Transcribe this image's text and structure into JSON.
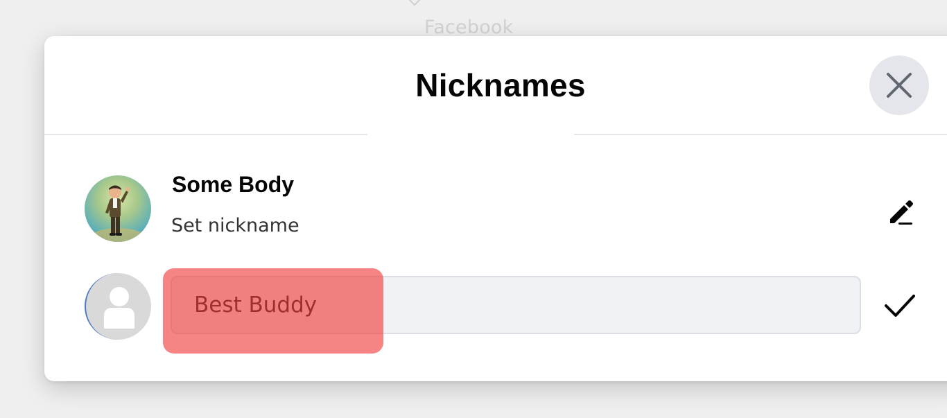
{
  "background": {
    "caption": "Facebook"
  },
  "dialog": {
    "title": "Nicknames",
    "close_icon": "close-icon"
  },
  "members": [
    {
      "name": "Some Body",
      "subtitle": "Set nickname",
      "action_icon": "pencil-icon"
    },
    {
      "nickname_value": "Best Buddy",
      "action_icon": "checkmark-icon"
    }
  ],
  "colors": {
    "highlight": "#f03838",
    "input_background": "#f0f2f5",
    "close_button_background": "#e4e6eb"
  }
}
